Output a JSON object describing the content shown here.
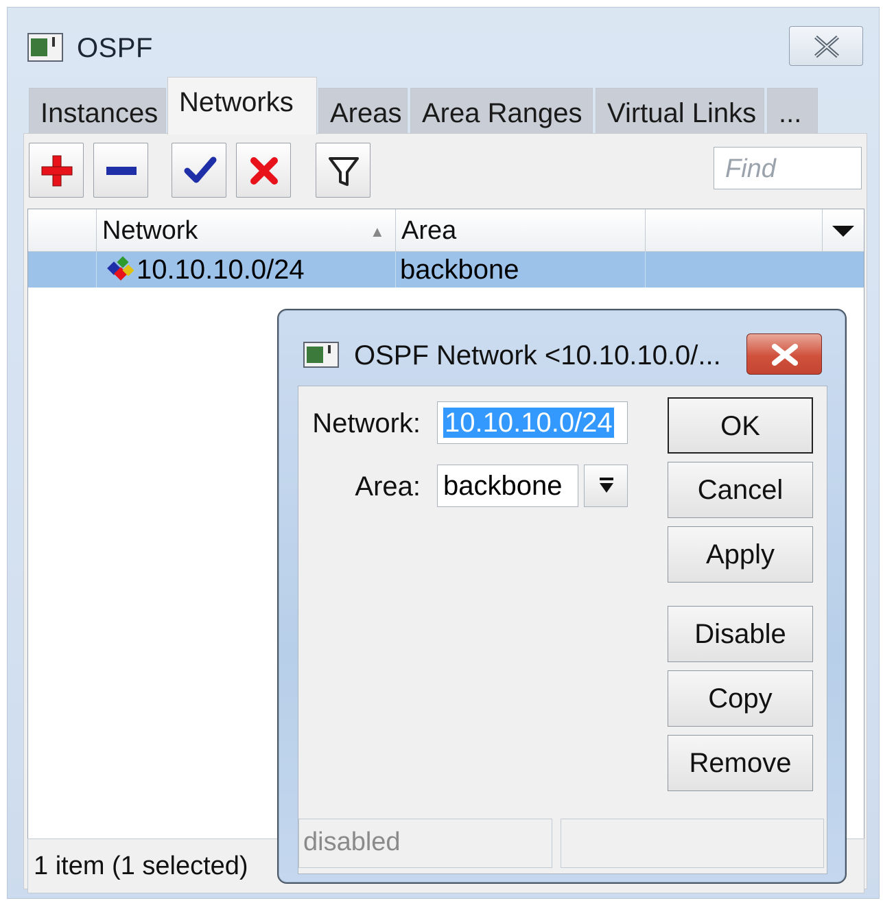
{
  "window": {
    "title": "OSPF",
    "icon": "window-app-icon",
    "close_icon": "close-icon"
  },
  "tabs": [
    {
      "label": "Instances",
      "active": false
    },
    {
      "label": "Networks",
      "active": true
    },
    {
      "label": "Areas",
      "active": false
    },
    {
      "label": "Area Ranges",
      "active": false
    },
    {
      "label": "Virtual Links",
      "active": false
    },
    {
      "label": "...",
      "active": false
    }
  ],
  "toolbar": {
    "buttons": [
      {
        "name": "add-button",
        "icon": "plus-icon",
        "color": "#e8121b"
      },
      {
        "name": "remove-button",
        "icon": "minus-icon",
        "color": "#1f2fa8"
      },
      {
        "name": "enable-button",
        "icon": "check-icon",
        "color": "#1f2fa8"
      },
      {
        "name": "disable-button",
        "icon": "x-icon",
        "color": "#e8121b"
      },
      {
        "name": "filter-button",
        "icon": "filter-icon",
        "color": "#222222"
      }
    ],
    "find_placeholder": "Find"
  },
  "table": {
    "columns": [
      {
        "label": ""
      },
      {
        "label": "Network",
        "sorted": "ascending"
      },
      {
        "label": "Area"
      },
      {
        "label": ""
      }
    ],
    "rows": [
      {
        "network": "10.10.10.0/24",
        "area": "backbone",
        "selected": true,
        "icon": "ospf-network-icon"
      }
    ],
    "column_menu_icon": "dropdown-triangle-icon"
  },
  "status": {
    "text": "1 item (1 selected)"
  },
  "dialog": {
    "title": "OSPF Network <10.10.10.0/...",
    "icon": "window-app-icon",
    "close_icon": "close-icon",
    "fields": {
      "network_label": "Network:",
      "network_value": "10.10.10.0/24",
      "area_label": "Area:",
      "area_value": "backbone"
    },
    "buttons": {
      "ok": "OK",
      "cancel": "Cancel",
      "apply": "Apply",
      "disable": "Disable",
      "copy": "Copy",
      "remove": "Remove"
    },
    "status_left": "disabled",
    "status_right": ""
  }
}
